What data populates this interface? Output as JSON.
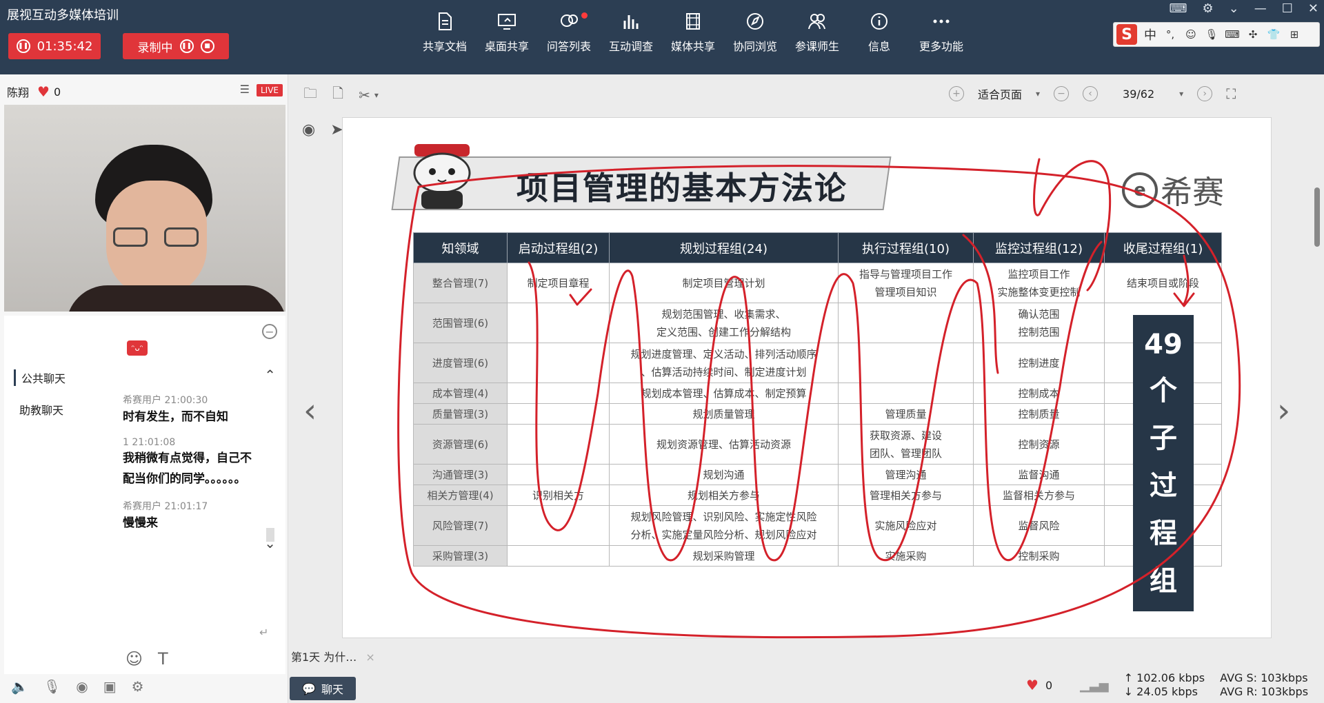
{
  "app": {
    "title": "展视互动多媒体培训"
  },
  "session": {
    "timer": "01:35:42",
    "recording_label": "录制中"
  },
  "toolbar": {
    "items": [
      {
        "label": "共享文档",
        "icon": "document-icon"
      },
      {
        "label": "桌面共享",
        "icon": "desktop-share-icon"
      },
      {
        "label": "问答列表",
        "icon": "qa-icon"
      },
      {
        "label": "互动调查",
        "icon": "survey-icon"
      },
      {
        "label": "媒体共享",
        "icon": "media-icon"
      },
      {
        "label": "协同浏览",
        "icon": "browse-icon"
      },
      {
        "label": "参课师生",
        "icon": "users-icon"
      },
      {
        "label": "信息",
        "icon": "info-icon"
      },
      {
        "label": "更多功能",
        "icon": "more-icon"
      }
    ]
  },
  "ime": {
    "lang": "中"
  },
  "presenter": {
    "name": "陈翔",
    "likes": "0",
    "live": "LIVE"
  },
  "chat": {
    "tabs": [
      "公共聊天",
      "助教聊天"
    ],
    "messages": [
      {
        "meta": "希赛用户 21:00:30",
        "text": "时有发生，而不自知"
      },
      {
        "meta": "1 21:01:08",
        "text": "我稍微有点觉得，自己不配当你们的同学。。。。。。"
      },
      {
        "meta": "希赛用户 21:01:17",
        "text": "慢慢来"
      }
    ],
    "sticker": "哈哈"
  },
  "doc": {
    "zoom": "适合页面",
    "page": "39/62"
  },
  "slide": {
    "title": "项目管理的基本方法论",
    "logo_text": "希赛",
    "logo_mark": "e",
    "headers": [
      "知领域",
      "启动过程组(2)",
      "规划过程组(24)",
      "执行过程组(10)",
      "监控过程组(12)",
      "收尾过程组(1)"
    ],
    "rows": [
      {
        "area": "整合管理(7)",
        "init": "制定项目章程",
        "plan": "制定项目管理计划",
        "exec": "指导与管理项目工作\n管理项目知识",
        "mon": "监控项目工作\n实施整体变更控制",
        "close": "结束项目或阶段"
      },
      {
        "area": "范围管理(6)",
        "init": "",
        "plan": "规划范围管理、收集需求、\n定义范围、创建工作分解结构",
        "exec": "",
        "mon": "确认范围\n控制范围",
        "close": ""
      },
      {
        "area": "进度管理(6)",
        "init": "",
        "plan": "规划进度管理、定义活动、排列活动顺序\n、估算活动持续时间、制定进度计划",
        "exec": "",
        "mon": "控制进度",
        "close": ""
      },
      {
        "area": "成本管理(4)",
        "init": "",
        "plan": "规划成本管理、估算成本、制定预算",
        "exec": "",
        "mon": "控制成本",
        "close": ""
      },
      {
        "area": "质量管理(3)",
        "init": "",
        "plan": "规划质量管理",
        "exec": "管理质量",
        "mon": "控制质量",
        "close": ""
      },
      {
        "area": "资源管理(6)",
        "init": "",
        "plan": "规划资源管理、估算活动资源",
        "exec": "获取资源、建设\n团队、管理团队",
        "mon": "控制资源",
        "close": ""
      },
      {
        "area": "沟通管理(3)",
        "init": "",
        "plan": "规划沟通",
        "exec": "管理沟通",
        "mon": "监督沟通",
        "close": ""
      },
      {
        "area": "相关方管理(4)",
        "init": "识别相关方",
        "plan": "规划相关方参与",
        "exec": "管理相关方参与",
        "mon": "监督相关方参与",
        "close": ""
      },
      {
        "area": "风险管理(7)",
        "init": "",
        "plan": "规划风险管理、识别风险、实施定性风险\n分析、实施定量风险分析、规划风险应对",
        "exec": "实施风险应对",
        "mon": "监督风险",
        "close": ""
      },
      {
        "area": "采购管理(3)",
        "init": "",
        "plan": "规划采购管理",
        "exec": "实施采购",
        "mon": "控制采购",
        "close": ""
      }
    ],
    "summary_chars": [
      "49",
      "个",
      "子",
      "过",
      "程",
      "组"
    ],
    "ink_color": "#d4212a"
  },
  "footer": {
    "chat_strip": "第1天  为什…",
    "chat_button": "聊天",
    "likes": "0",
    "upload": "102.06 kbps",
    "download": "24.05 kbps",
    "avg_s": "AVG S: 103kbps",
    "avg_r": "AVG R: 103kbps"
  }
}
